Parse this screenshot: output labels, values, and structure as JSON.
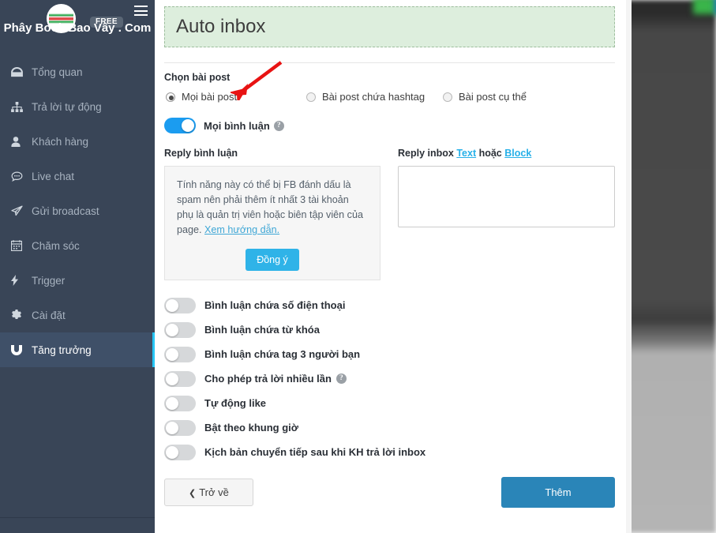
{
  "sidebar": {
    "brand": "Phây Book Bao Vây . Com",
    "badge": "FREE",
    "menu_icon": "hamburger-icon",
    "avatar_icon": "user-avatar",
    "items": [
      {
        "label": "Tổng quan",
        "icon": "dashboard-icon",
        "active": false
      },
      {
        "label": "Trả lời tự động",
        "icon": "sitemap-icon",
        "active": false
      },
      {
        "label": "Khách hàng",
        "icon": "user-icon",
        "active": false
      },
      {
        "label": "Live chat",
        "icon": "comment-icon",
        "active": false
      },
      {
        "label": "Gửi broadcast",
        "icon": "paper-plane-icon",
        "active": false
      },
      {
        "label": "Chăm sóc",
        "icon": "calendar-icon",
        "active": false
      },
      {
        "label": "Trigger",
        "icon": "bolt-icon",
        "active": false
      },
      {
        "label": "Cài đặt",
        "icon": "gear-icon",
        "active": false
      },
      {
        "label": "Tăng trưởng",
        "icon": "magnet-icon",
        "active": true
      }
    ]
  },
  "main": {
    "banner_title": "Auto inbox",
    "post_select": {
      "label": "Chọn bài post",
      "options": [
        {
          "label": "Mọi bài post",
          "selected": true
        },
        {
          "label": "Bài post chứa hashtag",
          "selected": false
        },
        {
          "label": "Bài post cụ thể",
          "selected": false
        }
      ]
    },
    "all_comments": {
      "label": "Mọi bình luận",
      "help_icon": "question-mark-icon",
      "on": true
    },
    "reply_comment": {
      "title": "Reply bình luận",
      "notice": "Tính năng này có thể bị FB đánh dấu là spam nên phải thêm ít nhất 3 tài khoản phụ là quản trị viên hoặc biên tập viên của page. ",
      "notice_link": "Xem hướng dẫn.",
      "agree_label": "Đồng ý"
    },
    "reply_inbox": {
      "title_prefix": "Reply inbox ",
      "title_link_1": "Text",
      "title_middle": " hoặc ",
      "title_link_2": "Block",
      "value": ""
    },
    "toggles": [
      {
        "label": "Bình luận chứa số điện thoại",
        "on": false,
        "help": false
      },
      {
        "label": "Bình luận chứa từ khóa",
        "on": false,
        "help": false
      },
      {
        "label": "Bình luận chứa tag 3 người bạn",
        "on": false,
        "help": false
      },
      {
        "label": "Cho phép trả lời nhiều lần",
        "on": false,
        "help": true
      },
      {
        "label": "Tự động like",
        "on": false,
        "help": false
      },
      {
        "label": "Bật theo khung giờ",
        "on": false,
        "help": false
      },
      {
        "label": "Kịch bản chuyển tiếp sau khi KH trả lời inbox",
        "on": false,
        "help": false
      }
    ],
    "footer": {
      "back_label": "Trở về",
      "back_icon": "chevron-left-icon",
      "submit_label": "Thêm"
    },
    "annotation": {
      "name": "red-arrow-annotation",
      "color": "#e81313"
    }
  }
}
